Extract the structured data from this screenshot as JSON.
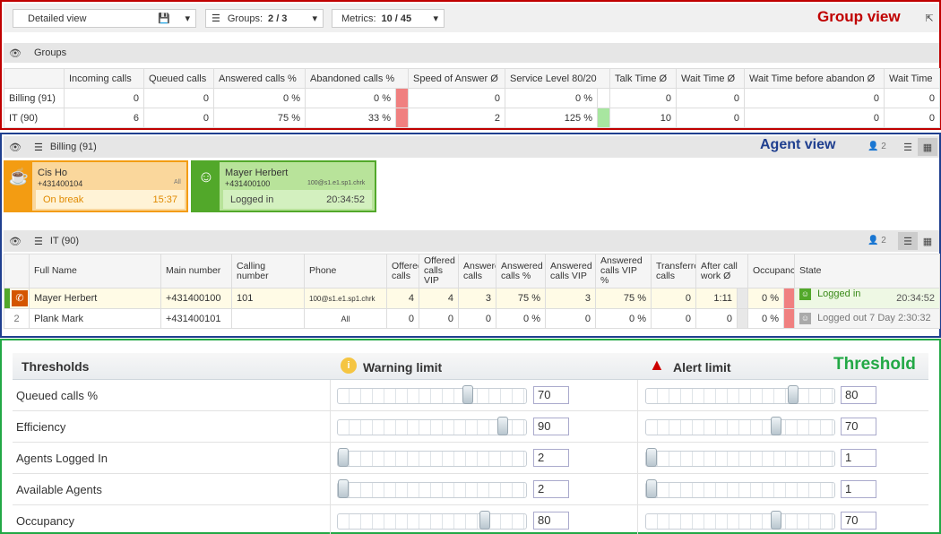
{
  "group_view": {
    "label": "Group view",
    "view_select": "Detailed view",
    "groups_label": "Groups:",
    "groups_value": "2 / 3",
    "metrics_label": "Metrics:",
    "metrics_value": "10 / 45",
    "section_title": "Groups",
    "columns": [
      "Incoming calls",
      "Queued calls",
      "Answered calls %",
      "Abandoned calls %",
      "Speed of Answer Ø",
      "Service Level 80/20",
      "Talk Time Ø",
      "Wait Time Ø",
      "Wait Time before abandon Ø",
      "Wait Time"
    ],
    "rows": [
      {
        "name": "Billing (91)",
        "cells": [
          "0",
          "0",
          "0 %",
          "0 %",
          "0",
          "0 %",
          "0",
          "0",
          "0",
          "0"
        ]
      },
      {
        "name": "IT (90)",
        "cells": [
          "6",
          "0",
          "75 %",
          "33 %",
          "2",
          "125 %",
          "10",
          "0",
          "0",
          "0"
        ]
      }
    ]
  },
  "agent_view": {
    "label": "Agent view",
    "billing": {
      "title": "Billing (91)",
      "count": "2",
      "cards": [
        {
          "name": "Cis Ho",
          "phone": "+431400104",
          "extra": "All",
          "status": "On break",
          "time": "15:37",
          "icon": "coffee-icon"
        },
        {
          "name": "Mayer Herbert",
          "phone": "+431400100",
          "extra": "100@s1.e1.sp1.chrk",
          "status": "Logged in",
          "time": "20:34:52",
          "icon": "headset-icon"
        }
      ]
    },
    "it": {
      "title": "IT (90)",
      "count": "2",
      "columns": [
        "Full Name",
        "Main number",
        "Calling number",
        "Phone",
        "Offered calls",
        "Offered calls VIP",
        "Answered calls",
        "Answered calls %",
        "Answered calls VIP",
        "Answered calls VIP %",
        "Transferred calls",
        "After call work Ø",
        "Occupancy",
        "State"
      ],
      "rows": [
        {
          "idx": "",
          "name": "Mayer Herbert",
          "main": "+431400100",
          "calling": "101",
          "phone": "100@s1.e1.sp1.chrk",
          "c1": "4",
          "c2": "4",
          "c3": "3",
          "c4": "75 %",
          "c5": "3",
          "c6": "75 %",
          "c7": "0",
          "c8": "1:11",
          "c9": "0 %",
          "state": "Logged in",
          "state_time": "20:34:52"
        },
        {
          "idx": "2",
          "name": "Plank Mark",
          "main": "+431400101",
          "calling": "",
          "phone": "All",
          "c1": "0",
          "c2": "0",
          "c3": "0",
          "c4": "0 %",
          "c5": "0",
          "c6": "0 %",
          "c7": "0",
          "c8": "0",
          "c9": "0 %",
          "state": "Logged out 7 Day 2:30:32",
          "state_time": ""
        }
      ]
    }
  },
  "threshold": {
    "label": "Threshold",
    "header": "Thresholds",
    "warning": "Warning limit",
    "alert": "Alert limit",
    "rows": [
      {
        "name": "Queued calls %",
        "warn": "70",
        "alert": "80",
        "warn_level": 0.7,
        "alert_level": 0.8
      },
      {
        "name": "Efficiency",
        "warn": "90",
        "alert": "70",
        "warn_level": 0.9,
        "alert_level": 0.7
      },
      {
        "name": "Agents Logged In",
        "warn": "2",
        "alert": "1",
        "warn_level": 0.0,
        "alert_level": 0.0
      },
      {
        "name": "Available Agents",
        "warn": "2",
        "alert": "1",
        "warn_level": 0.0,
        "alert_level": 0.0
      },
      {
        "name": "Occupancy",
        "warn": "80",
        "alert": "70",
        "warn_level": 0.8,
        "alert_level": 0.7
      }
    ]
  },
  "colors": {
    "group_frame": "#c00000",
    "agent_frame": "#1f3f8f",
    "threshold_frame": "#22a845",
    "onbreak": "#f39c12",
    "loggedin": "#52a82a"
  }
}
